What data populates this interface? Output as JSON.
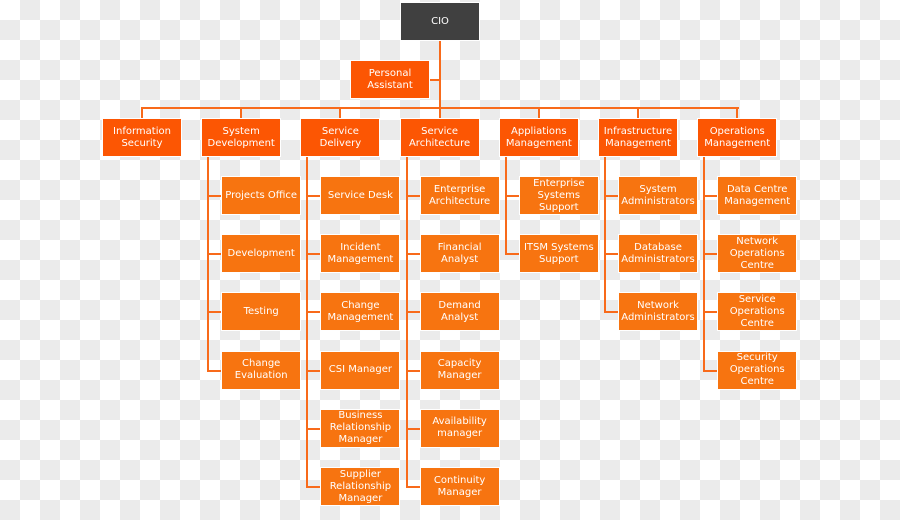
{
  "colors": {
    "cio": "#404040",
    "department": "#fc5603",
    "role": "#f77410",
    "connector": "#f86a1a"
  },
  "root": {
    "label": "CIO"
  },
  "assistant": {
    "label": "Personal Assistant"
  },
  "departments": [
    {
      "label": "Information Security",
      "children": []
    },
    {
      "label": "System Development",
      "children": [
        "Projects Office",
        "Development",
        "Testing",
        "Change Evaluation"
      ]
    },
    {
      "label": "Service Delivery",
      "children": [
        "Service Desk",
        "Incident Management",
        "Change Management",
        "CSI Manager",
        "Business Relationship Manager",
        "Supplier Relationship Manager"
      ]
    },
    {
      "label": "Service Architecture",
      "children": [
        "Enterprise Architecture",
        "Financial Analyst",
        "Demand Analyst",
        "Capacity Manager",
        "Availability manager",
        "Continuity Manager"
      ]
    },
    {
      "label": "Appliations Management",
      "children": [
        "Enterprise Systems Support",
        "ITSM Systems Support"
      ]
    },
    {
      "label": "Infrastructure Management",
      "children": [
        "System Administrators",
        "Database Administrators",
        "Network Administrators"
      ]
    },
    {
      "label": "Operations Management",
      "children": [
        "Data Centre Management",
        "Network Operations Centre",
        "Service Operations Centre",
        "Security Operations Centre"
      ]
    }
  ]
}
